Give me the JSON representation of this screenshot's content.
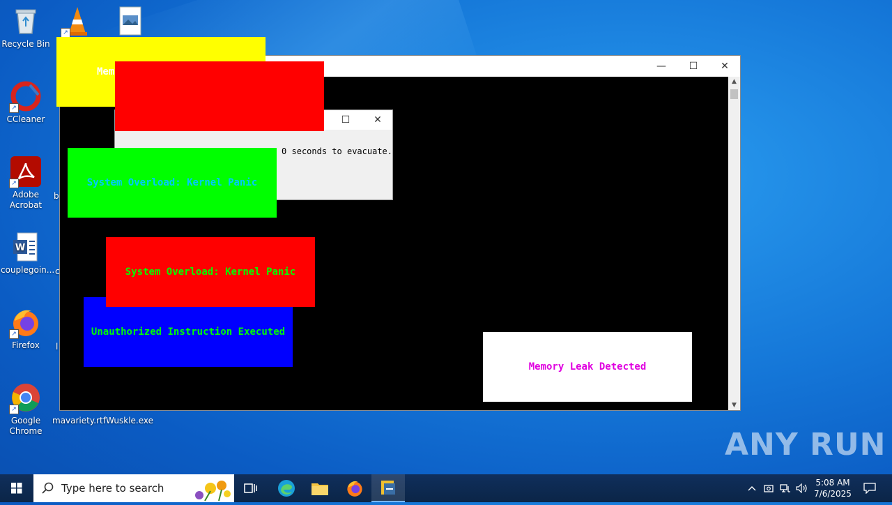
{
  "desktop": {
    "icons": [
      {
        "label": "Recycle Bin",
        "icon": "recycle-bin-icon"
      },
      {
        "label": "CCleaner",
        "icon": "ccleaner-icon"
      },
      {
        "label": "Adobe Acrobat",
        "icon": "adobe-acrobat-icon"
      },
      {
        "label": "couplegoin...",
        "icon": "word-document-icon"
      },
      {
        "label": "Firefox",
        "icon": "firefox-icon"
      },
      {
        "label": "Google Chrome",
        "icon": "chrome-icon"
      },
      {
        "label": "mavariety.rtf",
        "icon": "rtf-file-icon"
      },
      {
        "label": "Wuskle.exe",
        "icon": "exe-file-icon"
      }
    ],
    "partial_labels": [
      "b",
      "c",
      "l"
    ]
  },
  "main_window": {
    "minimize": "—",
    "maximize": "☐",
    "close": "✕"
  },
  "dialog": {
    "message": "0 seconds to evacuate.",
    "maximize": "☐",
    "close": "✕"
  },
  "popups": {
    "yellow_text": "Mem",
    "green_text": "System Overload: Kernel Panic",
    "red_text": "System Overload: Kernel Panic",
    "blue_text": "Unauthorized Instruction Executed",
    "white_text": "Memory Leak Detected"
  },
  "taskbar": {
    "search_placeholder": "Type here to search",
    "time": "5:08 AM",
    "date": "7/6/2025"
  },
  "watermark": "ANY RUN",
  "colors": {
    "yellow": "#ffff00",
    "red": "#ff0000",
    "green": "#00ff00",
    "blue": "#0000ff",
    "cyan_text": "#00c8ff",
    "green_text": "#00ff00",
    "magenta_text": "#e000e0"
  }
}
